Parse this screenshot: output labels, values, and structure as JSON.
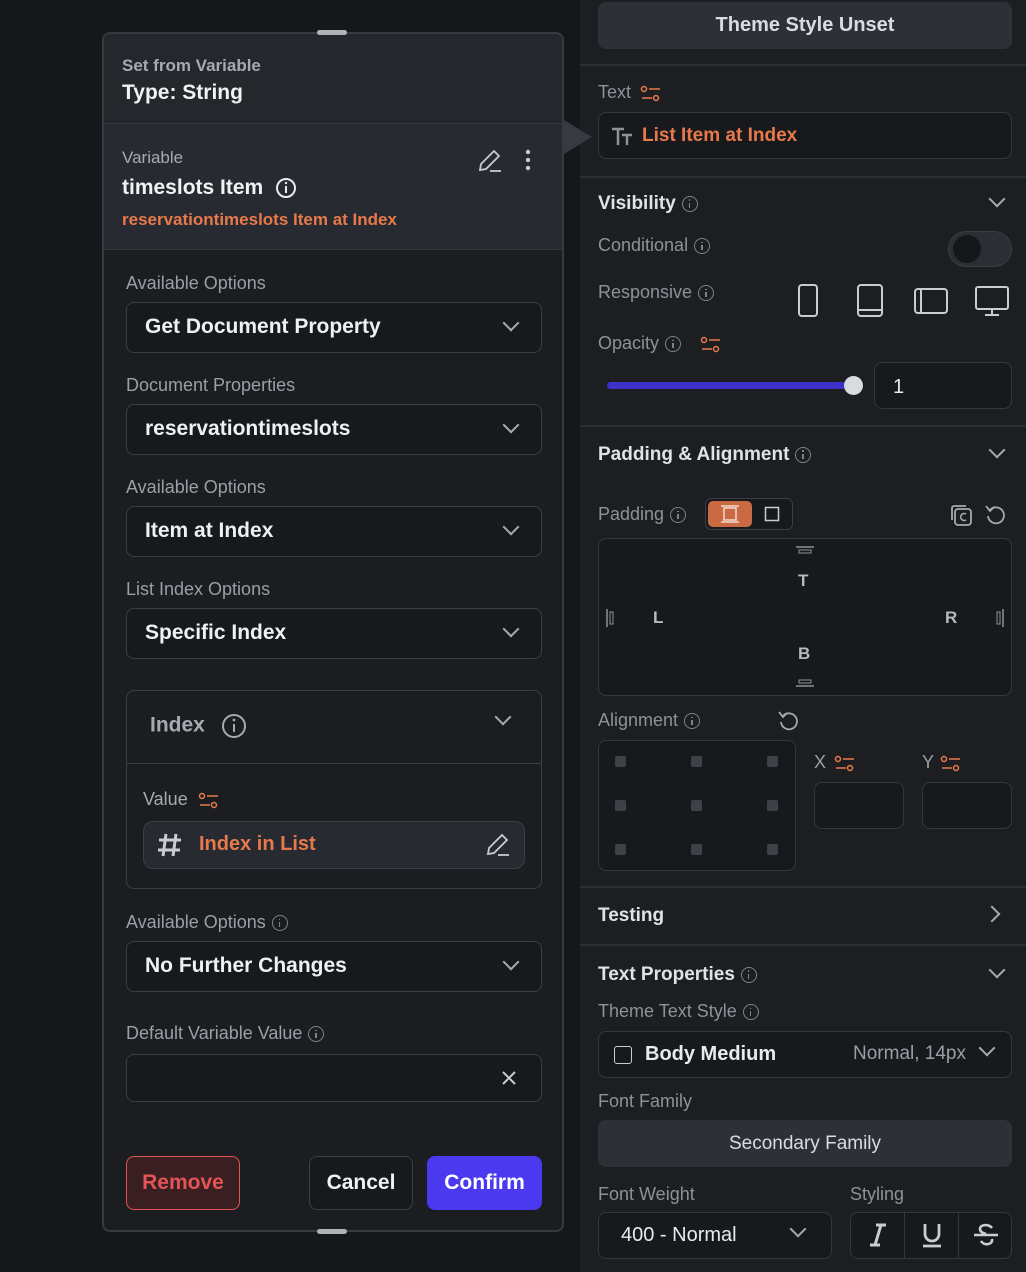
{
  "panel": {
    "theme_style_button": "Theme Style Unset",
    "text_label": "Text",
    "text_value": "List Item at Index",
    "visibility": {
      "title": "Visibility",
      "conditional_label": "Conditional",
      "responsive_label": "Responsive",
      "opacity_label": "Opacity",
      "opacity_value": "1",
      "opacity_fraction": 1.0
    },
    "padding_alignment": {
      "title": "Padding & Alignment",
      "padding_label": "Padding",
      "top": "T",
      "left": "L",
      "right": "R",
      "bottom": "B",
      "alignment_label": "Alignment",
      "x_label": "X",
      "y_label": "Y"
    },
    "testing": {
      "title": "Testing"
    },
    "text_properties": {
      "title": "Text Properties",
      "theme_text_style_label": "Theme Text Style",
      "style_name": "Body Medium",
      "style_detail": "Normal, 14px",
      "font_family_label": "Font Family",
      "font_family_value": "Secondary Family",
      "font_weight_label": "Font Weight",
      "font_weight_value": "400 - Normal",
      "styling_label": "Styling"
    }
  },
  "dialog": {
    "subtitle": "Set from Variable",
    "type_label": "Type: String",
    "variable_label": "Variable",
    "variable_name": "timeslots Item",
    "variable_path": "reservationtimeslots Item at Index",
    "fields": [
      {
        "label": "Available Options",
        "value": "Get Document Property"
      },
      {
        "label": "Document Properties",
        "value": "reservationtimeslots"
      },
      {
        "label": "Available Options",
        "value": "Item at Index"
      },
      {
        "label": "List Index Options",
        "value": "Specific Index"
      }
    ],
    "index": {
      "title": "Index",
      "value_label": "Value",
      "value": "Index in List"
    },
    "further": {
      "label": "Available Options",
      "value": "No Further Changes"
    },
    "default_label": "Default Variable Value",
    "default_value": "",
    "remove_label": "Remove",
    "cancel_label": "Cancel",
    "confirm_label": "Confirm"
  },
  "colors": {
    "accent_orange": "#e8794a",
    "confirm_blue": "#4b39ef",
    "remove_red": "#e35454",
    "slider_blue": "#3c31c9"
  }
}
